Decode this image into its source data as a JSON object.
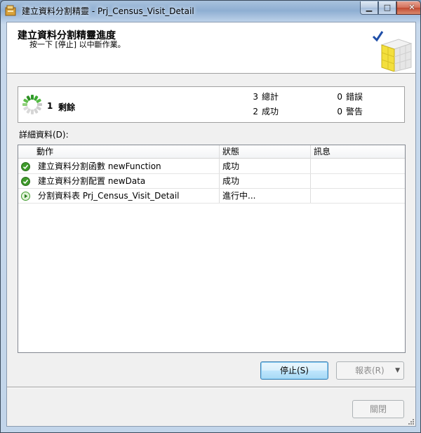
{
  "window": {
    "title": "建立資料分割精靈 - Prj_Census_Visit_Detail",
    "caption_minimize": "▁",
    "caption_maximize": "□",
    "caption_close": "✕"
  },
  "header": {
    "title": "建立資料分割精靈進度",
    "subtitle": "按一下 [停止] 以中斷作業。"
  },
  "summary": {
    "remaining_count": "1",
    "remaining_label": "剩餘",
    "total_count": "3",
    "total_label": "總計",
    "success_count": "2",
    "success_label": "成功",
    "error_count": "0",
    "error_label": "錯誤",
    "warning_count": "0",
    "warning_label": "警告"
  },
  "details": {
    "label": "詳細資料(D):",
    "columns": [
      "動作",
      "狀態",
      "訊息"
    ],
    "rows": [
      {
        "action": "建立資料分割函數 newFunction",
        "status": "成功",
        "message": "",
        "icon": "success-icon"
      },
      {
        "action": "建立資料分割配置 newData",
        "status": "成功",
        "message": "",
        "icon": "success-icon"
      },
      {
        "action": "分割資料表 Prj_Census_Visit_Detail",
        "status": "進行中...",
        "message": "",
        "icon": "in-progress-icon"
      }
    ]
  },
  "buttons": {
    "stop": "停止(S)",
    "report": "報表(R)",
    "report_dropdown": "▼",
    "close": "關閉"
  },
  "colors": {
    "success": "#3e9a2a",
    "accent": "#3c7fb1"
  }
}
